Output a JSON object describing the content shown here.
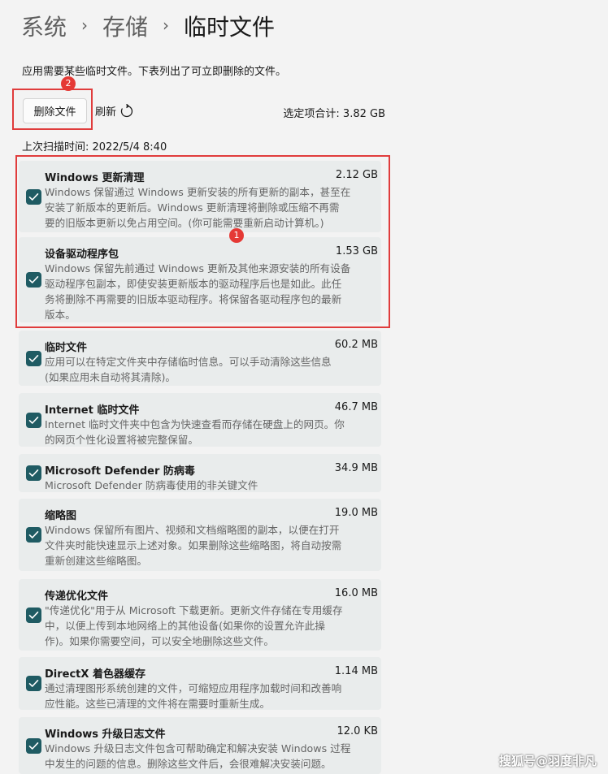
{
  "breadcrumb": {
    "level1": "系统",
    "level2": "存储",
    "current": "临时文件"
  },
  "description": "应用需要某些临时文件。下表列出了可立即删除的文件。",
  "toolbar": {
    "delete_label": "删除文件",
    "refresh_label": "刷新",
    "selected_total": "选定项合计: 3.82 GB"
  },
  "last_scan": "上次扫描时间: 2022/5/4 8:40",
  "annotations": {
    "badge1": "1",
    "badge2": "2"
  },
  "items": [
    {
      "title": "Windows 更新清理",
      "size": "2.12 GB",
      "checked": true,
      "lines": [
        "Windows 保留通过 Windows 更新安装的所有更新的副本，甚至在",
        "安装了新版本的更新后。Windows 更新清理将删除或压缩不再需",
        "要的旧版本更新以免占用空间。(你可能需要重新启动计算机。)"
      ]
    },
    {
      "title": "设备驱动程序包",
      "size": "1.53 GB",
      "checked": true,
      "lines": [
        "Windows 保留先前通过 Windows 更新及其他来源安装的所有设备",
        "驱动程序包副本，即使安装更新版本的驱动程序后也是如此。此任",
        "务将删除不再需要的旧版本驱动程序。将保留各驱动程序包的最新",
        "版本。"
      ]
    },
    {
      "title": "临时文件",
      "size": "60.2 MB",
      "checked": true,
      "lines": [
        "应用可以在特定文件夹中存储临时信息。可以手动清除这些信息",
        "(如果应用未自动将其清除)。"
      ]
    },
    {
      "title": "Internet 临时文件",
      "size": "46.7 MB",
      "checked": true,
      "lines": [
        "Internet 临时文件夹中包含为快速查看而存储在硬盘上的网页。你",
        "的网页个性化设置将被完整保留。"
      ]
    },
    {
      "title": "Microsoft Defender 防病毒",
      "size": "34.9 MB",
      "checked": true,
      "lines": [
        "Microsoft Defender 防病毒使用的非关键文件"
      ]
    },
    {
      "title": "缩略图",
      "size": "19.0 MB",
      "checked": true,
      "lines": [
        "Windows 保留所有图片、视频和文档缩略图的副本，以便在打开",
        "文件夹时能快速显示上述对象。如果删除这些缩略图，将自动按需",
        "重新创建这些缩略图。"
      ]
    },
    {
      "title": "传递优化文件",
      "size": "16.0 MB",
      "checked": true,
      "lines": [
        "\"传递优化\"用于从 Microsoft 下载更新。更新文件存储在专用缓存",
        "中，以便上传到本地网络上的其他设备(如果你的设置允许此操",
        "作)。如果你需要空间，可以安全地删除这些文件。"
      ]
    },
    {
      "title": "DirectX 着色器缓存",
      "size": "1.14 MB",
      "checked": true,
      "lines": [
        "通过清理图形系统创建的文件，可缩短应用程序加载时间和改善响",
        "应性能。这些已清理的文件将在需要时重新生成。"
      ]
    },
    {
      "title": "Windows 升级日志文件",
      "size": "12.0 KB",
      "checked": true,
      "lines": [
        "Windows 升级日志文件包含可帮助确定和解决安装 Windows 过程",
        "中发生的问题的信息。删除这些文件后，会很难解决安装问题。"
      ]
    }
  ],
  "watermark": "搜狐号@羽度非凡",
  "colors": {
    "accent": "#1f5b63",
    "highlight": "#e03c3c",
    "card": "#e9ecec",
    "background": "#f3f3f3"
  }
}
